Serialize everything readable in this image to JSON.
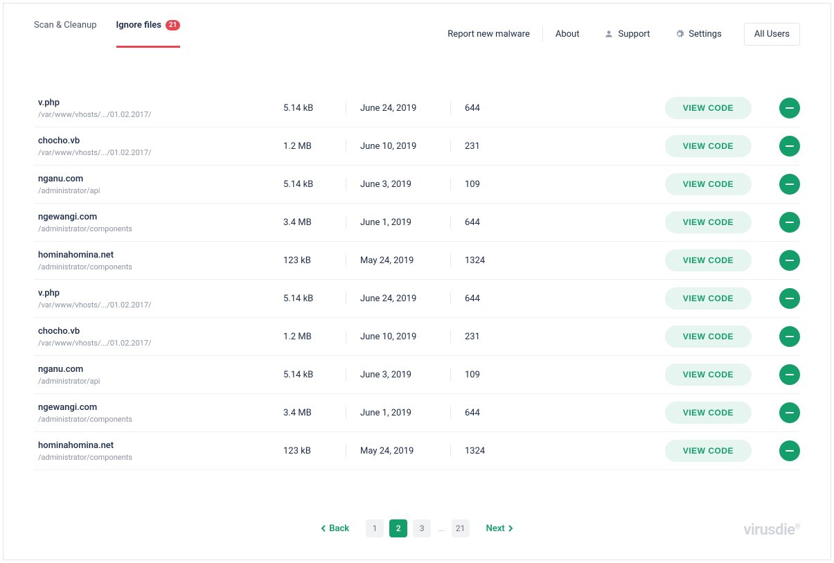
{
  "tabs": {
    "scan": "Scan & Cleanup",
    "ignore": "Ignore files",
    "ignore_badge": "21"
  },
  "topnav": {
    "report": "Report new malware",
    "about": "About",
    "support": "Support",
    "settings": "Settings",
    "dropdown": "All Users"
  },
  "buttons": {
    "view": "VIEW CODE"
  },
  "files": [
    {
      "name": "v.php",
      "path": "/var/www/vhosts/.../01.02.2017/",
      "size": "5.14 kB",
      "date": "June 24, 2019",
      "perm": "644"
    },
    {
      "name": "chocho.vb",
      "path": "/var/www/vhosts/.../01.02.2017/",
      "size": "1.2 MB",
      "date": "June 10, 2019",
      "perm": "231"
    },
    {
      "name": "nganu.com",
      "path": "/administrator/api",
      "size": "5.14 kB",
      "date": "June 3, 2019",
      "perm": "109"
    },
    {
      "name": "ngewangi.com",
      "path": "/administrator/components",
      "size": "3.4 MB",
      "date": "June 1, 2019",
      "perm": "644"
    },
    {
      "name": "hominahomina.net",
      "path": "/administrator/components",
      "size": "123 kB",
      "date": "May 24, 2019",
      "perm": "1324"
    },
    {
      "name": "v.php",
      "path": "/var/www/vhosts/.../01.02.2017/",
      "size": "5.14 kB",
      "date": "June 24, 2019",
      "perm": "644"
    },
    {
      "name": "chocho.vb",
      "path": "/var/www/vhosts/.../01.02.2017/",
      "size": "1.2 MB",
      "date": "June 10, 2019",
      "perm": "231"
    },
    {
      "name": "nganu.com",
      "path": "/administrator/api",
      "size": "5.14 kB",
      "date": "June 3, 2019",
      "perm": "109"
    },
    {
      "name": "ngewangi.com",
      "path": "/administrator/components",
      "size": "3.4 MB",
      "date": "June 1, 2019",
      "perm": "644"
    },
    {
      "name": "hominahomina.net",
      "path": "/administrator/components",
      "size": "123 kB",
      "date": "May 24, 2019",
      "perm": "1324"
    }
  ],
  "pagination": {
    "back": "Back",
    "next": "Next",
    "pages": [
      "1",
      "2",
      "3",
      "21"
    ],
    "current": "2",
    "ellipsis": "..."
  },
  "brand": "virusdie",
  "brand_mark": "®"
}
